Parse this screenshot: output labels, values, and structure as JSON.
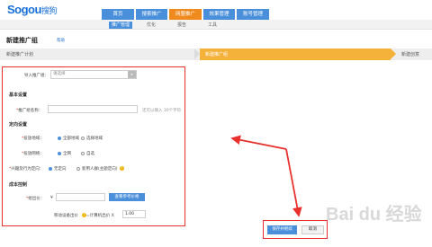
{
  "logo": {
    "text": "Sogou",
    "suffix": "搜狗"
  },
  "nav": [
    "首页",
    "搜索推广",
    "网盟推广",
    "效果管理",
    "账号管理"
  ],
  "subnav": [
    "推广管理",
    "优化",
    "报告",
    "工具"
  ],
  "page": {
    "title": "新建推广组",
    "help": "帮助"
  },
  "steps": [
    "新建推广计划",
    "新建推广组",
    "新建创意"
  ],
  "form": {
    "import_label": "导入推广组：",
    "import_value": "请选择",
    "basic_section": "基本设置",
    "name_label": "推广组名称：",
    "name_hint": "还可以输入 30个字符",
    "targeting_section": "定向设置",
    "region_label": "投放地域：",
    "region_opts": [
      "全部地域",
      "选择地域"
    ],
    "network_label": "投放网络：",
    "network_opts": [
      "全网",
      "自选"
    ],
    "interest_label": "兴趣及行为定向：",
    "interest_opts": [
      "无定向",
      "新用人群(主题定向)"
    ],
    "cost_section": "成本控制",
    "bid_label": "组出价：",
    "bid_prefix": "¥",
    "bid_button": "查看参考价格",
    "mobile_label": "移动设备出价",
    "mobile_formula": "=计算机出价 X",
    "mobile_value": "1.00"
  },
  "actions": {
    "save": "保存并继续",
    "cancel": "取消"
  },
  "watermark": "Bai du 经验",
  "colors": {
    "primary": "#4a8fd9",
    "accent": "#ef8a1e",
    "step_active": "#f5b23a",
    "highlight": "#e8312d"
  }
}
